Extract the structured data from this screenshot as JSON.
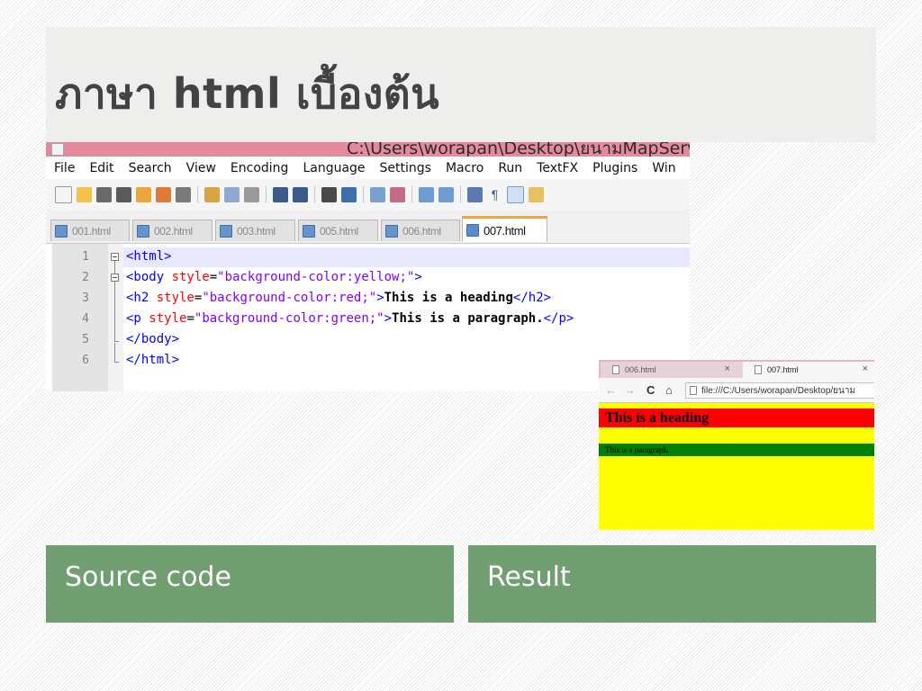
{
  "slide": {
    "title": "ภาษา html เบื้องต้น",
    "captions": {
      "left": "Source code",
      "right": "Result"
    }
  },
  "editor": {
    "window_title": "C:\\Users\\worapan\\Desktop\\ยนามMapServer_",
    "menu": [
      "File",
      "Edit",
      "Search",
      "View",
      "Encoding",
      "Language",
      "Settings",
      "Macro",
      "Run",
      "TextFX",
      "Plugins",
      "Win"
    ],
    "tabs": [
      "001.html",
      "002.html",
      "003.html",
      "005.html",
      "006.html",
      "007.html"
    ],
    "active_tab": "007.html",
    "line_numbers": [
      "1",
      "2",
      "3",
      "4",
      "5",
      "6"
    ],
    "code": {
      "l1_tag": "<html>",
      "l2_open": "<body ",
      "l2_attr": "style",
      "l2_eq": "=",
      "l2_str": "\"background-color:yellow;\"",
      "l2_close": ">",
      "l3_open": "<h2 ",
      "l3_attr": "style",
      "l3_eq": "=",
      "l3_str": "\"background-color:red;\"",
      "l3_gt": ">",
      "l3_text": "This is a heading",
      "l3_close": "</h2>",
      "l4_open": "<p ",
      "l4_attr": "style",
      "l4_eq": "=",
      "l4_str": "\"background-color:green;\"",
      "l4_gt": ">",
      "l4_text": "This is a paragraph.",
      "l4_close": "</p>",
      "l5_tag": "</body>",
      "l6_tag": "</html>"
    },
    "colors": {
      "tag": "#0000ff",
      "attribute": "#ff0000",
      "string": "#8000ff"
    }
  },
  "browser": {
    "tabs": [
      {
        "title": "006.html",
        "close": "×"
      },
      {
        "title": "007.html",
        "close": "×"
      }
    ],
    "nav": {
      "back": "←",
      "forward": "→",
      "reload": "C",
      "home": "⌂"
    },
    "url": "file:///C:/Users/worapan/Desktop/ยนาม",
    "content": {
      "heading": "This is a heading",
      "paragraph": "This is a paragraph.",
      "page_bg": "#ffff00",
      "heading_bg": "#ff0000",
      "paragraph_bg": "#008000"
    }
  },
  "theme": {
    "caption_bg": "#719f72",
    "title_color": "#434343"
  }
}
